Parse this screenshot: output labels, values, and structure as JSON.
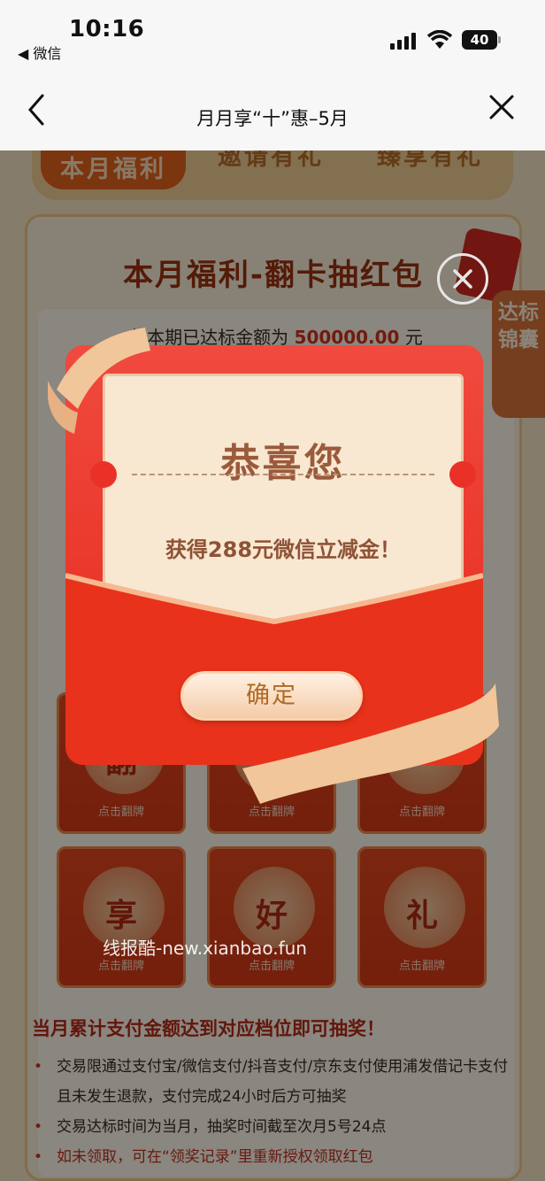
{
  "status_bar": {
    "time": "10:16",
    "back_app": "◀ 微信",
    "battery": "40"
  },
  "nav": {
    "title": "月月享“十”惠–5月"
  },
  "tabs": [
    {
      "label": "本月福利",
      "active": true
    },
    {
      "label": "邀请有礼",
      "active": false
    },
    {
      "label": "臻享有礼",
      "active": false
    }
  ],
  "card": {
    "title": "本月福利-翻卡抽红包",
    "achieved_prefix": "您本期已达标金额为",
    "achieved_amount": "500000.00",
    "achieved_unit": "元"
  },
  "side_tab": {
    "label": "达标锦囊"
  },
  "flip_cards": [
    {
      "char": "翻",
      "hint": "点击翻牌"
    },
    {
      "char": "",
      "hint": "点击翻牌"
    },
    {
      "char": "",
      "hint": "点击翻牌"
    },
    {
      "char": "享",
      "hint": "点击翻牌"
    },
    {
      "char": "好",
      "hint": "点击翻牌"
    },
    {
      "char": "礼",
      "hint": "点击翻牌"
    }
  ],
  "rules": {
    "head": "当月累计支付金额达到对应档位即可抽奖！",
    "items": [
      "交易限通过支付宝/微信支付/抖音支付/京东支付使用浦发借记卡支付且未发生退款，支付完成24小时后方可抽奖",
      "交易达标时间为当月，抽奖时间截至次月5号24点",
      "如未领取，可在“领奖记录”里重新授权领取红包"
    ]
  },
  "modal": {
    "title": "恭喜您",
    "prize": "获得288元微信立减金！",
    "confirm": "确定"
  },
  "watermark": "线报酷-new.xianbao.fun",
  "colors": {
    "accent": "#e6291d",
    "brand": "#e3621c",
    "gold": "#f2c887"
  }
}
